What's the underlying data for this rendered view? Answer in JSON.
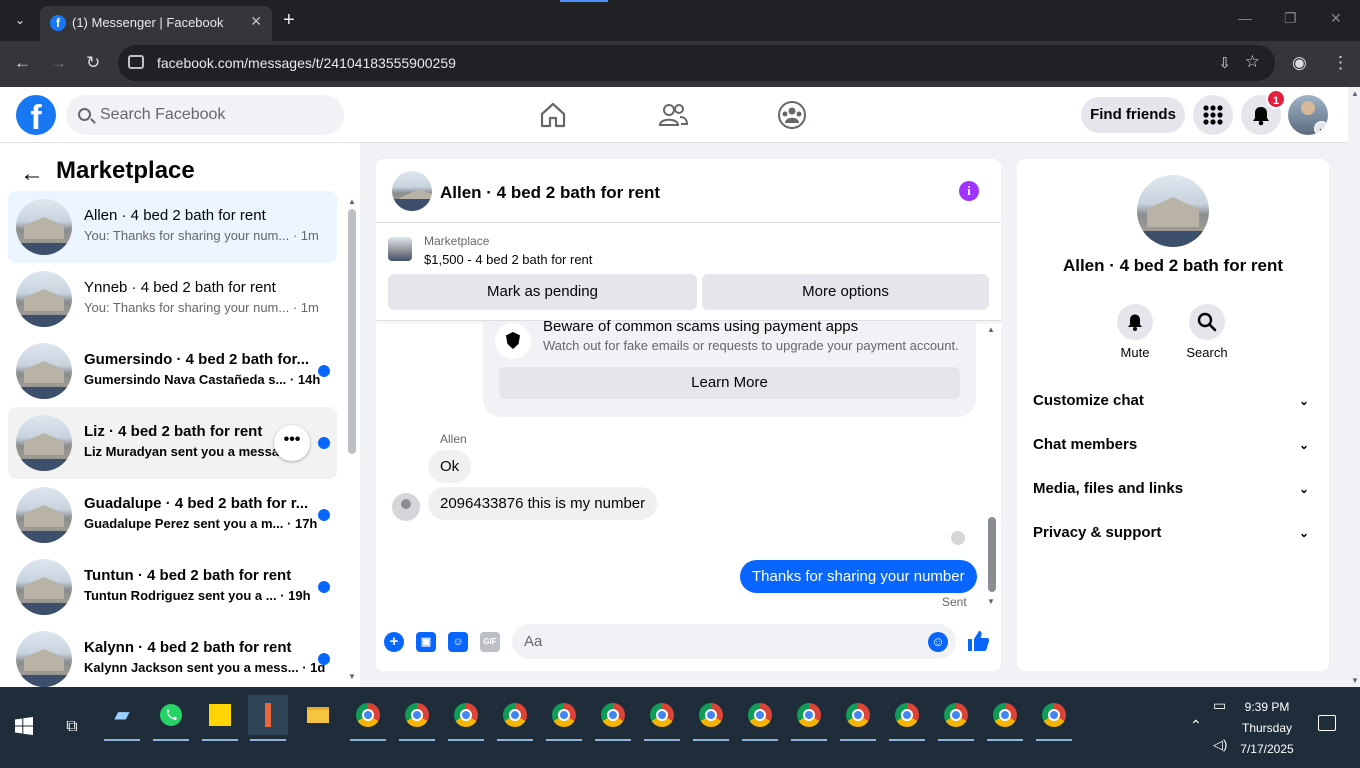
{
  "browser": {
    "tab_title": "(1) Messenger | Facebook",
    "url": "facebook.com/messages/t/24104183555900259"
  },
  "header": {
    "search_placeholder": "Search Facebook",
    "find_friends": "Find friends",
    "notification_count": "1"
  },
  "sidebar": {
    "title": "Marketplace",
    "conversations": [
      {
        "name": "Allen · 4 bed 2 bath for rent",
        "preview": "You: Thanks for sharing your num...",
        "time": "· 1m",
        "unread": false
      },
      {
        "name": "Ynneb · 4 bed 2 bath for rent",
        "preview": "You: Thanks for sharing your num...",
        "time": "· 1m",
        "unread": false
      },
      {
        "name": "Gumersindo · 4 bed 2 bath for...",
        "preview": "Gumersindo Nava Castañeda s...",
        "time": "· 14h",
        "unread": true
      },
      {
        "name": "Liz · 4 bed 2 bath for rent",
        "preview": "Liz Muradyan sent you a messa...",
        "time": "",
        "unread": true
      },
      {
        "name": "Guadalupe · 4 bed 2 bath for r...",
        "preview": "Guadalupe Perez sent you a m...",
        "time": "· 17h",
        "unread": true
      },
      {
        "name": "Tuntun · 4 bed 2 bath for rent",
        "preview": "Tuntun Rodriguez sent you a ...",
        "time": "· 19h",
        "unread": true
      },
      {
        "name": "Kalynn · 4 bed 2 bath for rent",
        "preview": "Kalynn Jackson sent you a mess...",
        "time": "· 1d",
        "unread": true
      }
    ]
  },
  "chat": {
    "title": "Allen · 4 bed 2 bath for rent",
    "listing_label": "Marketplace",
    "listing_price": "$1,500 - 4 bed 2 bath for rent",
    "mark_pending": "Mark as pending",
    "more_options": "More options",
    "scam_title": "Beware of common scams using payment apps",
    "scam_text": "Watch out for fake emails or requests to upgrade your payment account.",
    "learn_more": "Learn More",
    "sender": "Allen",
    "messages": [
      {
        "text": "Ok",
        "dir": "in"
      },
      {
        "text": "2096433876 this is my number",
        "dir": "in"
      },
      {
        "text": "Thanks for sharing your number",
        "dir": "out"
      }
    ],
    "sent_status": "Sent",
    "input_placeholder": "Aa",
    "gif_label": "GIF"
  },
  "details": {
    "name": "Allen · 4 bed 2 bath for rent",
    "mute": "Mute",
    "search": "Search",
    "sections": [
      "Customize chat",
      "Chat members",
      "Media, files and links",
      "Privacy & support"
    ]
  },
  "taskbar": {
    "time": "9:39 PM",
    "day": "Thursday",
    "date": "7/17/2025"
  },
  "colors": {
    "accent": "#0866ff",
    "brand": "#1877f2",
    "badge": "#e41e3f",
    "info": "#a033ff"
  }
}
